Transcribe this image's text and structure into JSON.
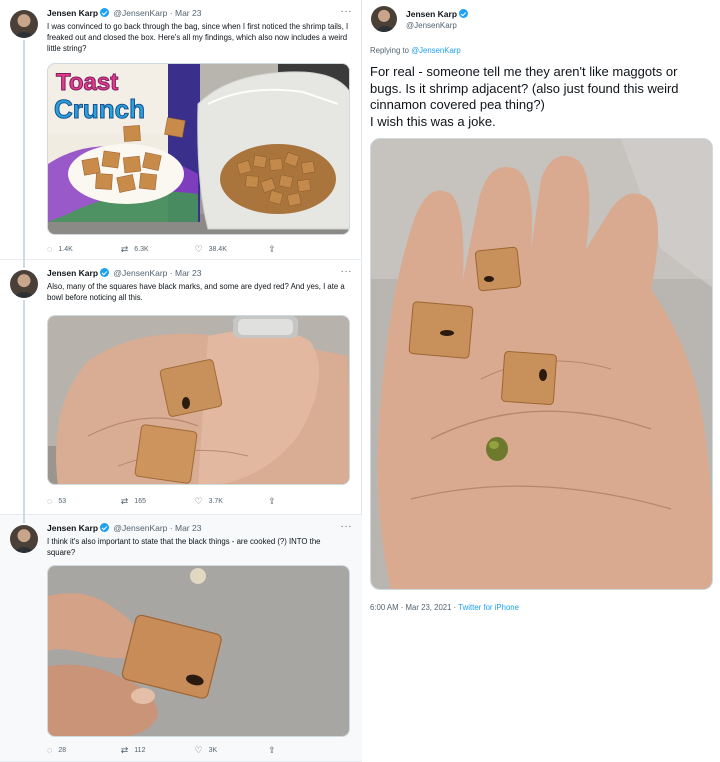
{
  "thread": [
    {
      "author": "Jensen Karp",
      "handle": "@JensenKarp",
      "separator": "·",
      "date": "Mar 23",
      "more": "···",
      "text": "I was convinced to go back through the bag, since when I first noticed the shrimp tails, I freaked out and closed the box. Here's all my findings, which also now includes a weird little string?",
      "media_label": "Toast Crunch",
      "actions": {
        "replies": "1.4K",
        "retweets": "6.3K",
        "likes": "38.4K"
      }
    },
    {
      "author": "Jensen Karp",
      "handle": "@JensenKarp",
      "separator": "·",
      "date": "Mar 23",
      "more": "···",
      "text": "Also, many of the squares have black marks, and some are dyed red? And yes, I ate a bowl before noticing all this.",
      "actions": {
        "replies": "53",
        "retweets": "165",
        "likes": "3.7K"
      }
    },
    {
      "author": "Jensen Karp",
      "handle": "@JensenKarp",
      "separator": "·",
      "date": "Mar 23",
      "more": "···",
      "text": "I think it's also important to state that the black things - are cooked (?) INTO the square?",
      "actions": {
        "replies": "28",
        "retweets": "112",
        "likes": "3K"
      }
    }
  ],
  "focused_tweet": {
    "author": "Jensen Karp",
    "handle": "@JensenKarp",
    "replying_prefix": "Replying to",
    "replying_to": "@JensenKarp",
    "text_lines": [
      "For real - someone tell me they aren't like maggots or",
      "bugs. Is it shrimp adjacent? (also just found this weird",
      "cinnamon covered pea thing?)",
      "I wish this was a joke."
    ],
    "timestamp": "6:00 AM · Mar 23, 2021",
    "separator": "·",
    "client": "Twitter for iPhone"
  },
  "colors": {
    "accent": "#1da1f2",
    "secondary_text": "#536471",
    "border": "#e6ecf0"
  },
  "icons": [
    "reply-icon",
    "retweet-icon",
    "like-icon",
    "share-icon",
    "verified-badge-icon",
    "more-icon"
  ]
}
